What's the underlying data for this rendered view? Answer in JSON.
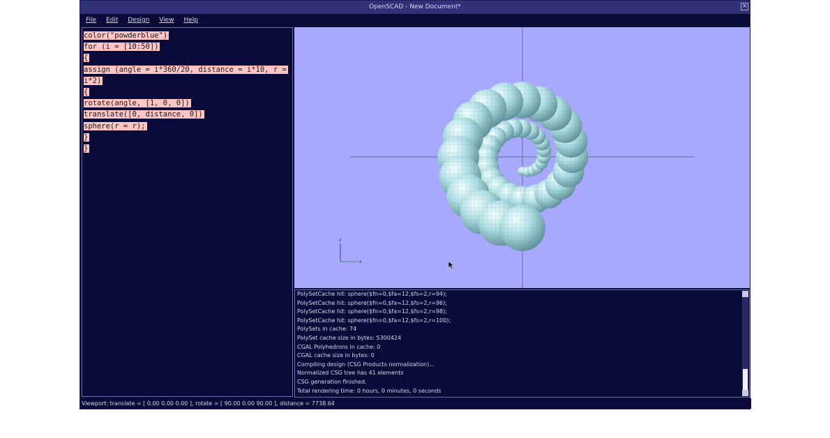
{
  "window": {
    "title": "OpenSCAD - New Document*"
  },
  "menu": {
    "items": [
      "File",
      "Edit",
      "Design",
      "View",
      "Help"
    ]
  },
  "editor": {
    "lines": [
      "color(\"powderblue\")",
      "for (i = [10:50])",
      "{",
      "assign (angle = i*360/20, distance = i*10, r =",
      "i*2)",
      "{",
      "rotate(angle, [1, 0, 0])",
      "translate([0, distance, 0])",
      "sphere(r = r);",
      "}",
      "}"
    ]
  },
  "viewport": {
    "background": "#a8a8ff",
    "sphere_color": "#b0e0e6",
    "axes": {
      "vertical": "z",
      "horizontal": "x"
    }
  },
  "console": {
    "lines": [
      "PolySetCache hit: sphere($fn=0,$fa=12,$fs=2,r=94);",
      "PolySetCache hit: sphere($fn=0,$fa=12,$fs=2,r=96);",
      "PolySetCache hit: sphere($fn=0,$fa=12,$fs=2,r=98);",
      "PolySetCache hit: sphere($fn=0,$fa=12,$fs=2,r=100);",
      "PolySets in cache: 74",
      "PolySet cache size in bytes: 5300424",
      "CGAL Polyhedrons in cache: 0",
      "CGAL cache size in bytes: 0",
      "Compiling design (CSG Products normalization)...",
      "Normalized CSG tree has 41 elements",
      "CSG generation finished.",
      "Total rendering time: 0 hours, 0 minutes, 0 seconds"
    ]
  },
  "status": {
    "text": "Viewport: translate = [ 0.00 0.00 0.00 ], rotate = [ 90.00 0.00 90.00 ], distance = 7738.64"
  }
}
